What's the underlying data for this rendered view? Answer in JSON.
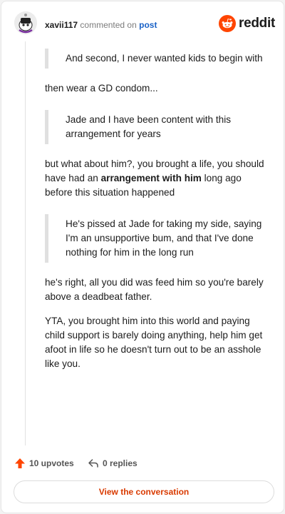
{
  "header": {
    "username": "xavii117",
    "action_text": "commented on",
    "post_link": "post",
    "brand": "reddit"
  },
  "comment": {
    "blocks": [
      {
        "type": "quote",
        "text": "And second, I never wanted kids to begin with"
      },
      {
        "type": "para",
        "text": "then wear a GD condom..."
      },
      {
        "type": "quote",
        "text": "Jade and I have been content with this arrangement for years"
      },
      {
        "type": "para",
        "parts": [
          "but what about him?, you brought a life, you should have had an ",
          "arrangement with him",
          " long ago before this situation happened"
        ]
      },
      {
        "type": "quote",
        "text": "He's pissed at Jade for taking my side, saying I'm an unsupportive bum, and that I've done nothing for him in the long run"
      },
      {
        "type": "para",
        "text": "he's right, all you did was feed him so you're barely above a deadbeat father."
      },
      {
        "type": "para",
        "text": "YTA, you brought him into this world and paying child support is barely doing anything, help him get afoot in life so he doesn't turn out to be an asshole like you."
      }
    ]
  },
  "footer": {
    "upvotes": "10 upvotes",
    "replies": "0 replies",
    "cta": "View the conversation"
  },
  "colors": {
    "upvote": "#ff4500",
    "link": "#1a62c7",
    "cta": "#d93a00",
    "reddit_orange": "#ff4500"
  },
  "icons": {
    "avatar": "snoo-avatar",
    "logo": "reddit-snoo-icon",
    "upvote": "upvote-arrow-icon",
    "reply": "reply-arrow-icon"
  }
}
